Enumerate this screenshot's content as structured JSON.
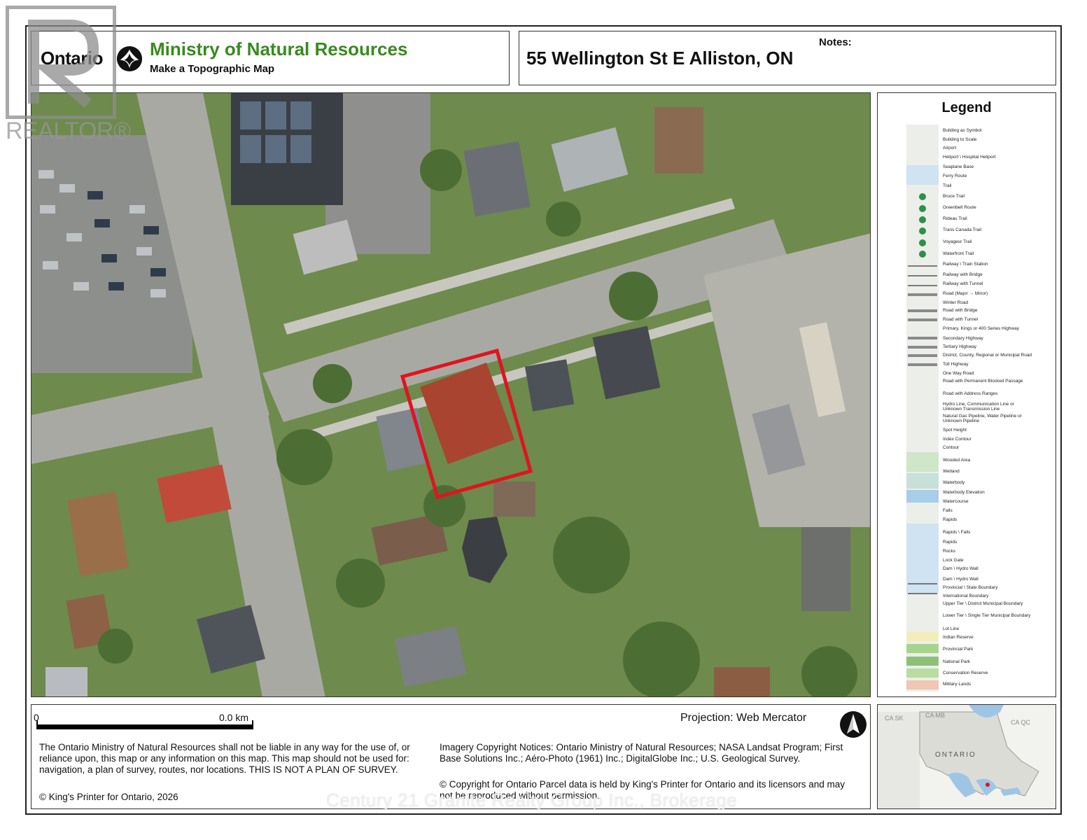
{
  "header": {
    "brand": "Ontario",
    "ministry": "Ministry of Natural Resources",
    "subtitle": "Make a Topographic Map",
    "address": "55 Wellington St E Alliston, ON",
    "notes_label": "Notes:"
  },
  "legend": {
    "title": "Legend",
    "items": [
      "Building as Symbol",
      "Building to Scale",
      "Airport",
      "Heliport \\ Hospital Heliport",
      "Seaplane Base",
      "Ferry Route",
      "Trail",
      "Bruce Trail",
      "Greenbelt Route",
      "Rideau Trail",
      "Trans Canada Trail",
      "Voyageur Trail",
      "Waterfront Trail",
      "Railway \\ Train Station",
      "Railway with Bridge",
      "Railway with Tunnel",
      "Road (Major → Minor)",
      "Winter Road",
      "Road with Bridge",
      "Road with Tunnel",
      "Primary, Kings or 400 Series Highway",
      "Secondary Highway",
      "Tertiary Highway",
      "District, County, Regional or Municipal Road",
      "Toll Highway",
      "One Way Road",
      "Road with Permanent Blocked Passage",
      "Road with Address Ranges",
      "Hydro Line, Communication Line or Unknown Transmission Line",
      "Natural Gas Pipeline, Water Pipeline or Unknown Pipeline",
      "Spot Height",
      "Index Contour",
      "Contour",
      "Wooded Area",
      "Wetland",
      "Waterbody",
      "Waterbody Elevation",
      "Watercourse",
      "Falls",
      "Rapids",
      "Rapids \\ Falls",
      "Rapids",
      "Rocks",
      "Lock Gate",
      "Dam \\ Hydro Wall",
      "Dam \\ Hydro Wall",
      "Provincial \\ State Boundary",
      "International Boundary",
      "Upper Tier \\ District Municipal Boundary",
      "Lower Tier \\ Single Tier Municipal Boundary",
      "Lot Line",
      "Indian Reserve",
      "Provincial Park",
      "National Park",
      "Conservation Reserve",
      "Military Lands"
    ]
  },
  "scale": {
    "start": "0",
    "end": "0.0 km"
  },
  "projection": "Projection: Web Mercator",
  "disclaimer": "The Ontario Ministry of Natural Resources shall not be liable in any way for the use of, or reliance upon, this map or any information on this map.  This map should not be used for: navigation, a plan of survey, routes, nor locations. THIS IS NOT A PLAN OF SURVEY.",
  "kings_printer": "© King's Printer for Ontario, 2026",
  "imagery_notice": "Imagery Copyright Notices: Ontario Ministry of Natural Resources; NASA Landsat Program; First Base Solutions Inc.; Aéro-Photo (1961) Inc.; DigitalGlobe Inc.; U.S. Geological Survey.",
  "parcel_copyright": "© Copyright for Ontario Parcel data is held by King's Printer for Ontario and its licensors and may not be reproduced without permission.",
  "inset_map": {
    "labels": [
      "CA SK",
      "CA MB",
      "CA QC",
      "ONTARIO"
    ]
  },
  "watermark": "Century 21 Granite Realty Group Inc., Brokerage",
  "realtor_watermark": "REALTOR®",
  "colors": {
    "ministry_green": "#3a8a1e",
    "parcel_outline": "#e0141e",
    "map_grass": "#6f8f4f",
    "map_road": "#a9a9a3"
  }
}
